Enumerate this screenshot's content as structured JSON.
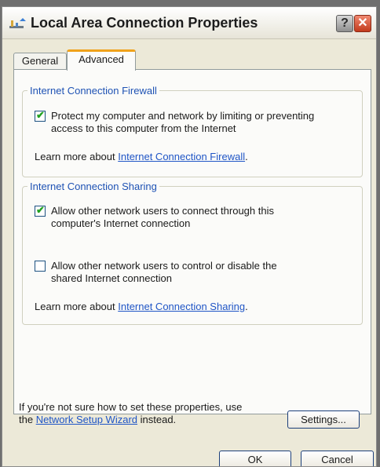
{
  "window": {
    "title": "Local Area Connection Properties",
    "help_label": "?",
    "close_label": "✕"
  },
  "tabs": [
    {
      "label": "General",
      "active": false
    },
    {
      "label": "Advanced",
      "active": true
    }
  ],
  "firewall": {
    "legend": "Internet Connection Firewall",
    "protect_checked": true,
    "protect_line1": "Protect my computer and network by limiting or preventing",
    "protect_line2": "access to this computer from the Internet",
    "learn_prefix": "Learn more about ",
    "learn_link": "Internet Connection Firewall",
    "learn_suffix": "."
  },
  "sharing": {
    "legend": "Internet Connection Sharing",
    "allow_connect_checked": true,
    "allow_connect_line1": "Allow other network users to connect through this",
    "allow_connect_line2": "computer's Internet connection",
    "allow_control_checked": false,
    "allow_control_line1": "Allow other network users to control or disable the",
    "allow_control_line2": "shared Internet connection",
    "learn_prefix": "Learn more about ",
    "learn_link": "Internet Connection Sharing",
    "learn_suffix": "."
  },
  "footer": {
    "hint_line1": "If you're not sure how to set these properties, use",
    "hint_prefix": "the ",
    "hint_link": "Network Setup Wizard",
    "hint_suffix": " instead.",
    "settings_label": "Settings...",
    "ok_label": "OK",
    "cancel_label": "Cancel"
  },
  "colors": {
    "accent_tab": "#f0a21a",
    "legend_text": "#1e52b4",
    "link": "#1f55c6",
    "check_mark": "#21a121",
    "close_button": "#c23a1c"
  }
}
